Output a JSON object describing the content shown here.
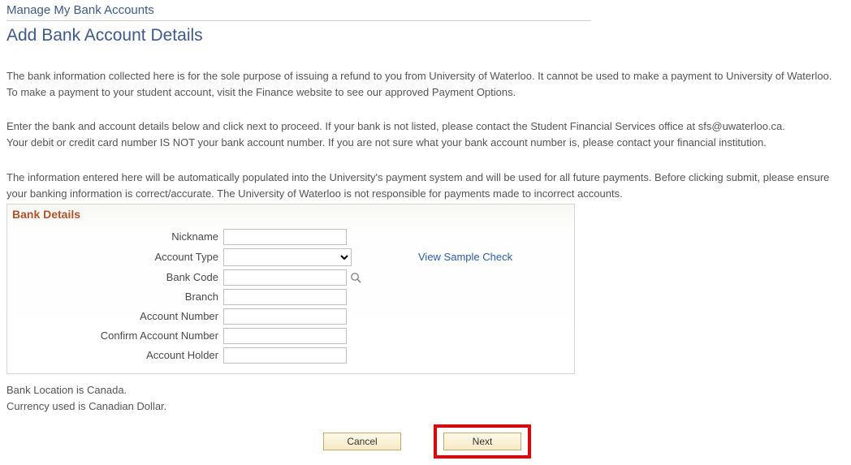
{
  "breadcrumb": "Manage My Bank Accounts",
  "page_title": "Add Bank Account Details",
  "intro1_line1": "The bank information collected here is for the sole purpose of issuing a refund to you from University of Waterloo. It cannot be used to make a payment to University of Waterloo.",
  "intro1_line2": "To make a payment to your student account, visit the Finance website to see our approved Payment Options.",
  "intro2_line1": "Enter the bank and account details below and click next to proceed. If your bank is not listed, please contact the Student Financial Services office at sfs@uwaterloo.ca.",
  "intro2_line2": "Your debit or credit card number IS NOT your bank account number. If you are not sure what your bank account number is, please contact your financial institution.",
  "intro3_line1": "The information entered here will be automatically populated into the University's payment system and will be used for all future payments. Before clicking submit, please ensure",
  "intro3_line2": "your banking information is correct/accurate. The University of Waterloo is not responsible for payments made to incorrect accounts.",
  "fieldset_title": "Bank Details",
  "labels": {
    "nickname": "Nickname",
    "account_type": "Account Type",
    "bank_code": "Bank Code",
    "branch": "Branch",
    "account_number": "Account Number",
    "confirm_account_number": "Confirm Account Number",
    "account_holder": "Account Holder"
  },
  "fields": {
    "nickname": "",
    "account_type": "",
    "bank_code": "",
    "branch": "",
    "account_number": "",
    "confirm_account_number": "",
    "account_holder": ""
  },
  "view_sample_check": "View Sample Check",
  "foot1": "Bank Location is Canada.",
  "foot2": "Currency used is Canadian Dollar.",
  "buttons": {
    "cancel": "Cancel",
    "next": "Next"
  }
}
